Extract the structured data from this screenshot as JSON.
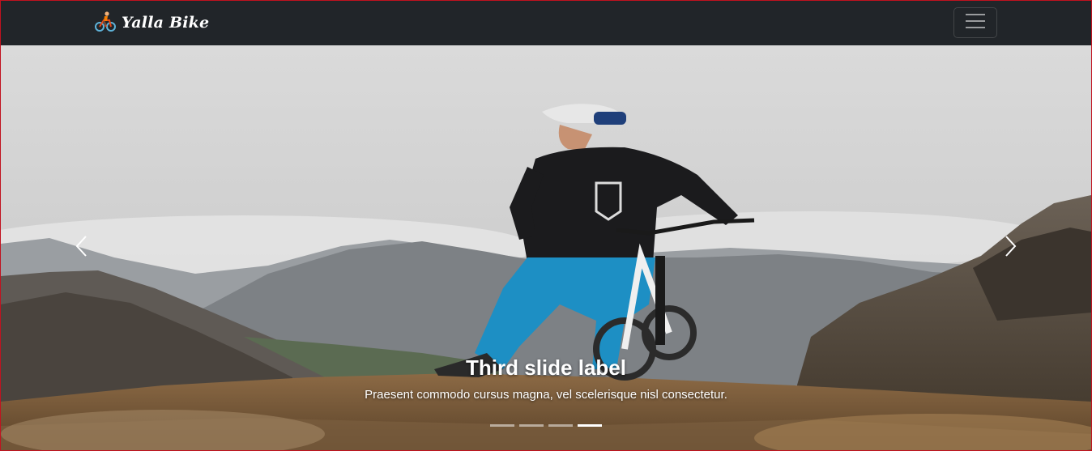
{
  "navbar": {
    "brand_text": "Yalla Bike",
    "brand_logo_icon": "cyclist-icon",
    "toggler_icon": "hamburger-menu-icon",
    "background": "#212529"
  },
  "carousel": {
    "active_index": 3,
    "slide_count": 4,
    "caption_title": "Third slide label",
    "caption_text": "Praesent commodo cursus magna, vel scelerisque nisl consectetur.",
    "prev_icon": "chevron-left-icon",
    "next_icon": "chevron-right-icon"
  }
}
